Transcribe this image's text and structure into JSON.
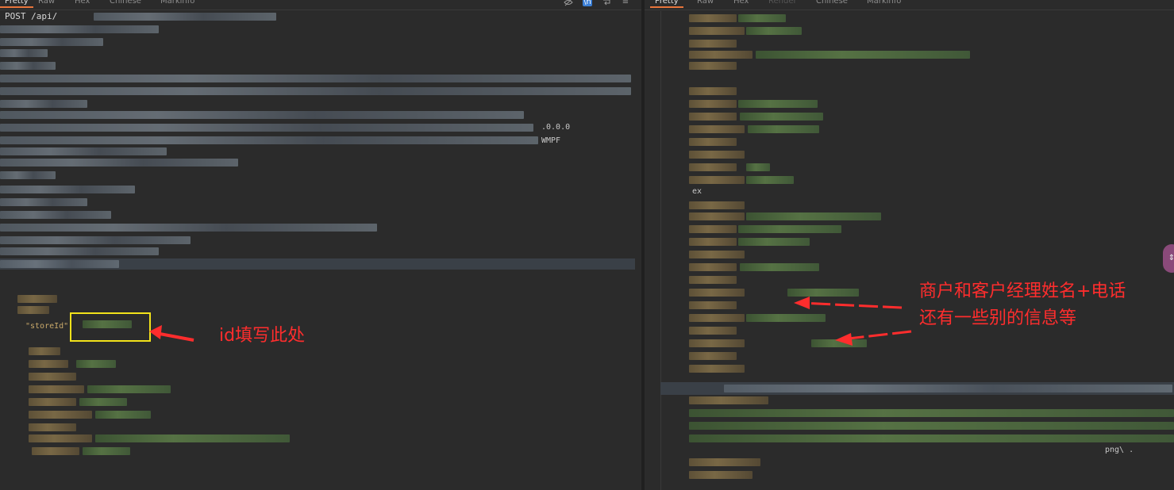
{
  "left_tabs": [
    "Pretty",
    "Raw",
    "Hex",
    "Chinese",
    "Markinfo"
  ],
  "left_active_tab": "Pretty",
  "toolbar_icons": [
    "eye-off-icon",
    "ln-icon",
    "wrap-icon",
    "menu-icon"
  ],
  "toolbar_ln_label": "\\n",
  "toolbar_menu_label": "≡",
  "request_line": "POST /api/",
  "visible_fragments": {
    "ip_tail": ".0.0.0",
    "wmpf": "WMPF",
    "store_key": "\"storeId\":",
    "right_fragment_1": "ex",
    "right_fragment_2": "png\\ ."
  },
  "right_tabs": [
    "Pretty",
    "Raw",
    "Hex",
    "Render",
    "Chinese",
    "Markinfo"
  ],
  "right_active_tab": "Pretty",
  "right_disabled_tab": "Render",
  "annotations": {
    "left": "id填写此处",
    "right_line1": "商户和客户经理姓名+电话",
    "right_line2": "还有一些别的信息等"
  },
  "colors": {
    "background": "#2b2b2b",
    "accent_tab": "#e8743b",
    "annotation_red": "#ff2d2d",
    "highlight_box": "#f2e21a"
  }
}
